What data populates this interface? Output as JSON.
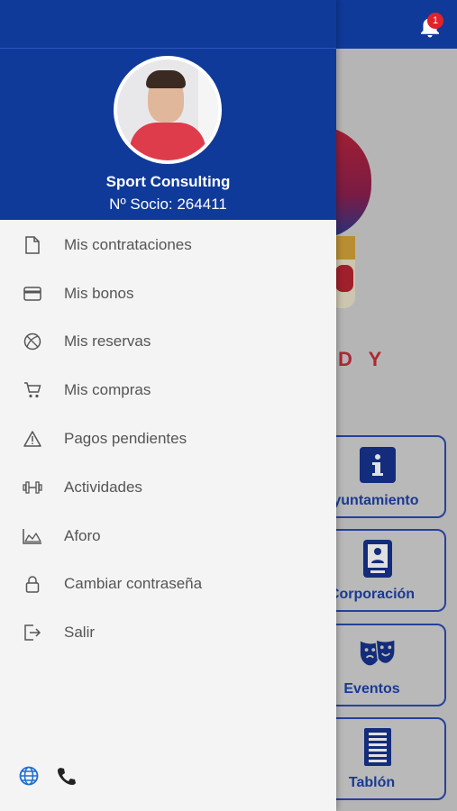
{
  "notifications": {
    "count": "1",
    "icon": "bell-icon"
  },
  "background": {
    "partial_text": "D Y",
    "tiles": [
      {
        "label": "ayuntamiento",
        "icon": "info-icon"
      },
      {
        "label": "Corporación",
        "icon": "id-card-icon"
      },
      {
        "label": "Eventos",
        "icon": "theater-masks-icon"
      },
      {
        "label": "Tablón",
        "icon": "notice-board-icon"
      }
    ]
  },
  "drawer": {
    "user": {
      "name": "Sport Consulting",
      "member_id": "Nº Socio: 264411"
    },
    "menu": [
      {
        "label": "Mis contrataciones",
        "icon": "document-icon"
      },
      {
        "label": "Mis bonos",
        "icon": "card-icon"
      },
      {
        "label": "Mis reservas",
        "icon": "ball-icon"
      },
      {
        "label": "Mis compras",
        "icon": "cart-icon"
      },
      {
        "label": "Pagos pendientes",
        "icon": "warning-icon"
      },
      {
        "label": "Actividades",
        "icon": "dumbbell-icon"
      },
      {
        "label": "Aforo",
        "icon": "area-chart-icon"
      },
      {
        "label": "Cambiar contraseña",
        "icon": "lock-icon"
      },
      {
        "label": "Salir",
        "icon": "logout-icon"
      }
    ],
    "footer": {
      "language_icon": "globe-icon",
      "contact_icon": "phone-icon"
    }
  },
  "colors": {
    "brand_blue": "#0f3a9a",
    "accent_red": "#e0222b",
    "menu_text": "#555555"
  }
}
